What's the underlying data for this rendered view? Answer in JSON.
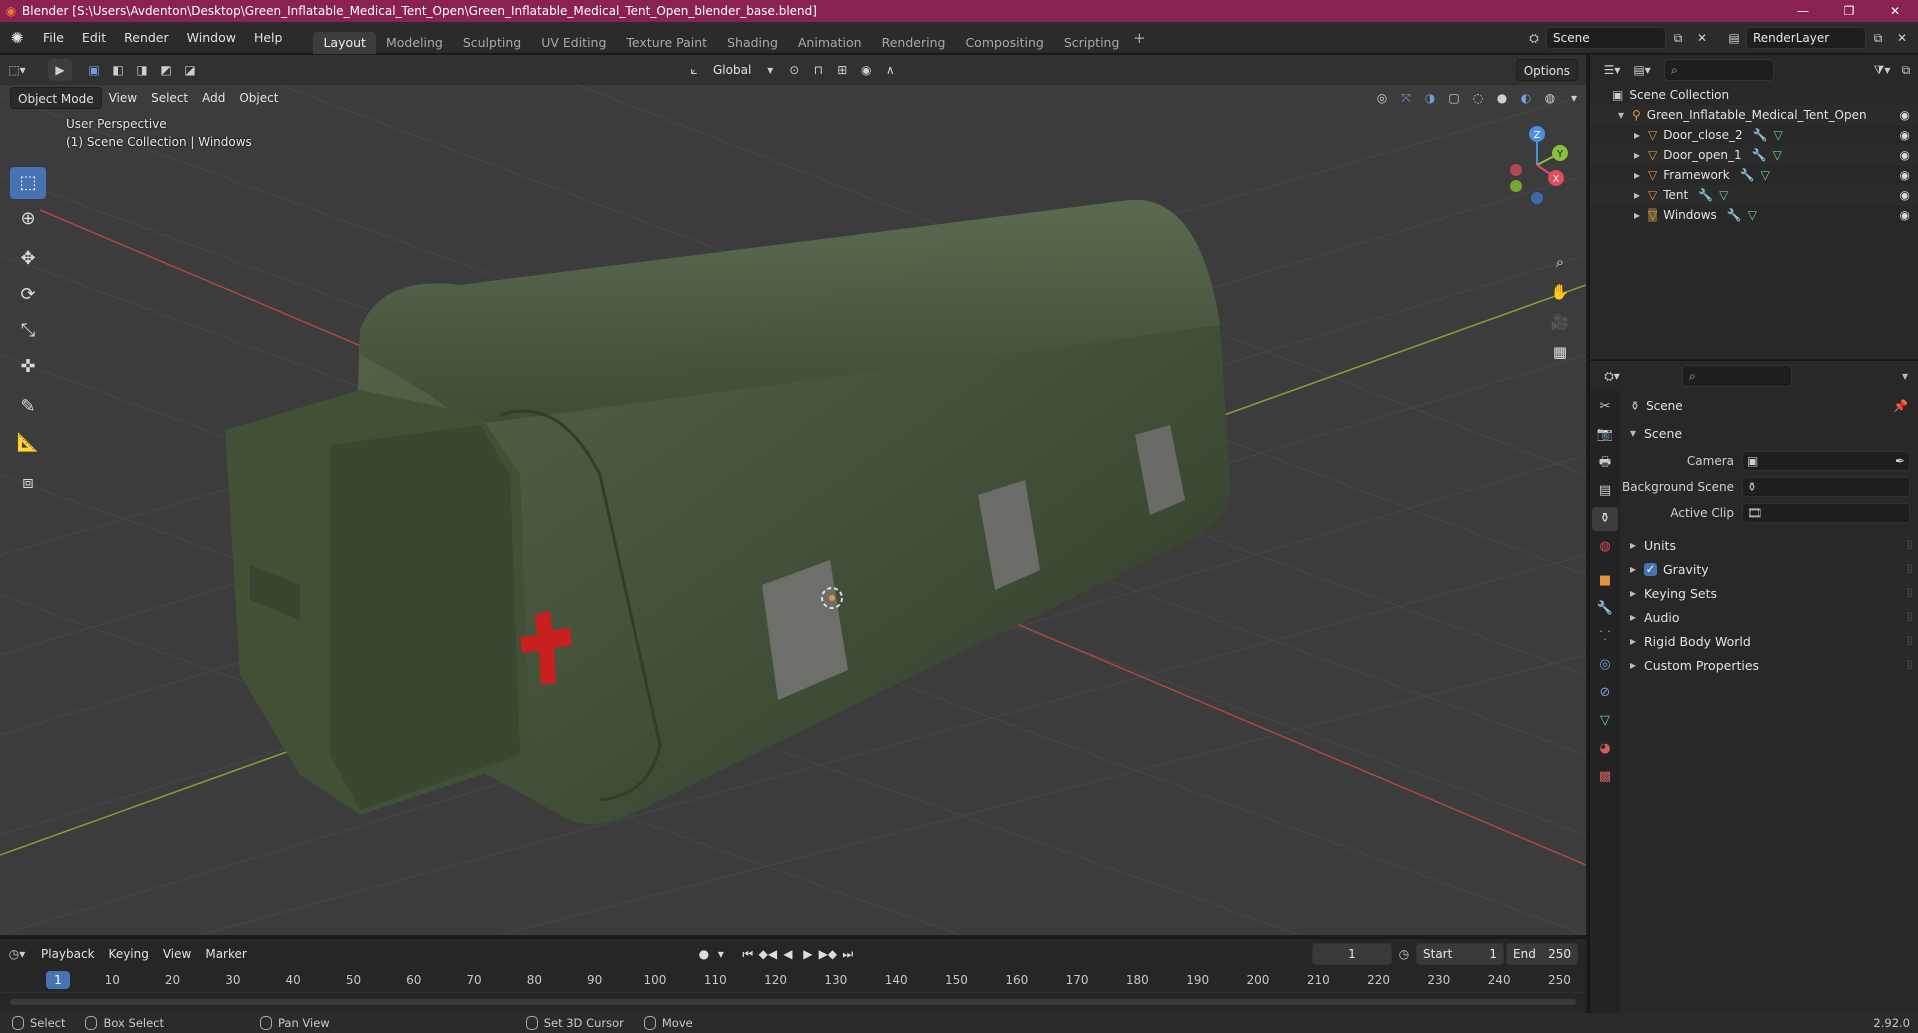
{
  "window": {
    "title": "Blender [S:\\Users\\Avdenton\\Desktop\\Green_Inflatable_Medical_Tent_Open\\Green_Inflatable_Medical_Tent_Open_blender_base.blend]",
    "controls": [
      "—",
      "❐",
      "✕"
    ]
  },
  "menu": {
    "items": [
      "File",
      "Edit",
      "Render",
      "Window",
      "Help"
    ]
  },
  "workspaces": [
    "Layout",
    "Modeling",
    "Sculpting",
    "UV Editing",
    "Texture Paint",
    "Shading",
    "Animation",
    "Rendering",
    "Compositing",
    "Scripting"
  ],
  "scene_selector": {
    "value": "Scene"
  },
  "layer_selector": {
    "value": "RenderLayer"
  },
  "viewport": {
    "transform_orientation": "Global",
    "options_label": "Options",
    "mode": "Object Mode",
    "menus": [
      "View",
      "Select",
      "Add",
      "Object"
    ],
    "perspective": "User Perspective",
    "collection_info": "(1) Scene Collection | Windows",
    "gizmo_axes": {
      "z": "Z",
      "y": "Y",
      "x": "X"
    },
    "colors": {
      "background": "#3c3c3c",
      "grid": "#4a4a4a",
      "x_axis": "#c84c4c",
      "y_axis": "#8cbc3c",
      "tent": "#45533b"
    }
  },
  "timeline": {
    "menus": [
      "Playback",
      "Keying",
      "View",
      "Marker"
    ],
    "current_frame": "1",
    "start_label": "Start",
    "start_value": "1",
    "end_label": "End",
    "end_value": "250",
    "ticks": [
      "10",
      "20",
      "30",
      "40",
      "50",
      "60",
      "70",
      "80",
      "90",
      "100",
      "110",
      "120",
      "130",
      "140",
      "150",
      "160",
      "170",
      "180",
      "190",
      "200",
      "210",
      "220",
      "230",
      "240",
      "250"
    ]
  },
  "statusbar": {
    "items": [
      "Select",
      "Box Select",
      "Pan View",
      "Set 3D Cursor",
      "Move"
    ],
    "version": "2.92.0"
  },
  "outliner": {
    "root": "Scene Collection",
    "collection": "Green_Inflatable_Medical_Tent_Open",
    "objects": [
      "Door_close_2",
      "Door_open_1",
      "Framework",
      "Tent",
      "Windows"
    ]
  },
  "properties": {
    "context": "Scene",
    "panel": "Scene",
    "fields": [
      {
        "label": "Camera"
      },
      {
        "label": "Background Scene"
      },
      {
        "label": "Active Clip"
      }
    ],
    "sections": [
      "Units",
      "Gravity",
      "Keying Sets",
      "Audio",
      "Rigid Body World",
      "Custom Properties"
    ],
    "gravity_checked": true,
    "accent": "#4772b3"
  }
}
